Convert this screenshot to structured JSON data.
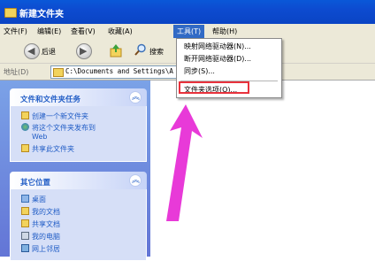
{
  "window": {
    "title": "新建文件夹"
  },
  "menubar": {
    "items": [
      "文件(F)",
      "编辑(E)",
      "查看(V)",
      "收藏(A)",
      "工具(T)",
      "帮助(H)"
    ]
  },
  "toolbar": {
    "back_label": "后退",
    "search_label": "搜索"
  },
  "address": {
    "label": "地址(D)",
    "value": "C:\\Documents and Settings\\A"
  },
  "tasks_panel": {
    "title": "文件和文件夹任务",
    "items": [
      "创建一个新文件夹",
      "将这个文件夹发布到",
      "Web",
      "共享此文件夹"
    ]
  },
  "places_panel": {
    "title": "其它位置",
    "items": [
      "桌面",
      "我的文档",
      "共享文档",
      "我的电脑",
      "网上邻居"
    ]
  },
  "tools_menu": {
    "items": [
      "映射网络驱动器(N)...",
      "断开网络驱动器(D)...",
      "同步(S)...",
      "文件夹选项(O)..."
    ]
  },
  "colors": {
    "accent": "#e8323c",
    "arrow": "#e83ad8",
    "title_bar": "#0a58d8"
  }
}
